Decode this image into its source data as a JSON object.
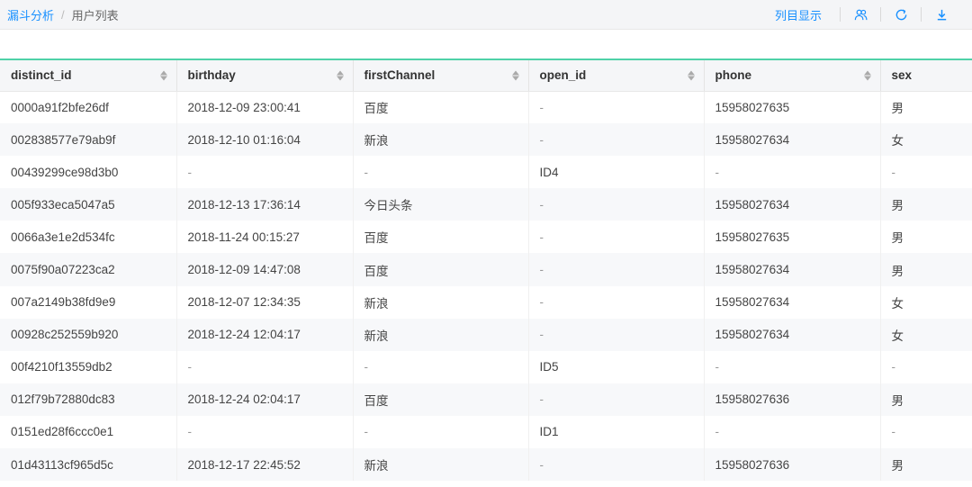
{
  "breadcrumb": {
    "parent": "漏斗分析",
    "separator": "/",
    "current": "用户列表"
  },
  "toolbar": {
    "columns_label": "列目显示",
    "icons": [
      "users-icon",
      "refresh-icon",
      "download-icon"
    ]
  },
  "colors": {
    "accent": "#1890ff",
    "table_top_border": "#4fd1a8"
  },
  "table": {
    "columns": [
      "distinct_id",
      "birthday",
      "firstChannel",
      "open_id",
      "phone",
      "sex"
    ],
    "rows": [
      [
        "0000a91f2bfe26df",
        "2018-12-09 23:00:41",
        "百度",
        "-",
        "15958027635",
        "男"
      ],
      [
        "002838577e79ab9f",
        "2018-12-10 01:16:04",
        "新浪",
        "-",
        "15958027634",
        "女"
      ],
      [
        "00439299ce98d3b0",
        "-",
        "-",
        "ID4",
        "-",
        "-"
      ],
      [
        "005f933eca5047a5",
        "2018-12-13 17:36:14",
        "今日头条",
        "-",
        "15958027634",
        "男"
      ],
      [
        "0066a3e1e2d534fc",
        "2018-11-24 00:15:27",
        "百度",
        "-",
        "15958027635",
        "男"
      ],
      [
        "0075f90a07223ca2",
        "2018-12-09 14:47:08",
        "百度",
        "-",
        "15958027634",
        "男"
      ],
      [
        "007a2149b38fd9e9",
        "2018-12-07 12:34:35",
        "新浪",
        "-",
        "15958027634",
        "女"
      ],
      [
        "00928c252559b920",
        "2018-12-24 12:04:17",
        "新浪",
        "-",
        "15958027634",
        "女"
      ],
      [
        "00f4210f13559db2",
        "-",
        "-",
        "ID5",
        "-",
        "-"
      ],
      [
        "012f79b72880dc83",
        "2018-12-24 02:04:17",
        "百度",
        "-",
        "15958027636",
        "男"
      ],
      [
        "0151ed28f6ccc0e1",
        "-",
        "-",
        "ID1",
        "-",
        "-"
      ],
      [
        "01d43113cf965d5c",
        "2018-12-17 22:45:52",
        "新浪",
        "-",
        "15958027636",
        "男"
      ]
    ]
  }
}
